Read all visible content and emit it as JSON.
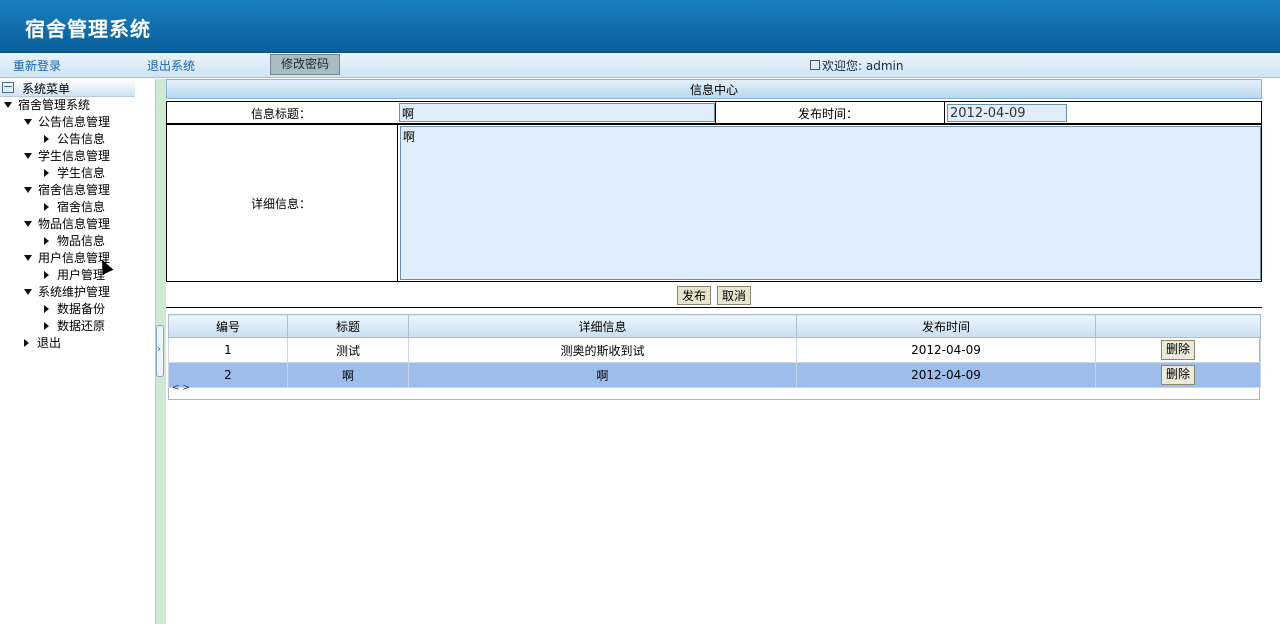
{
  "header": {
    "title": "宿舍管理系统"
  },
  "toolbar": {
    "relogin": "重新登录",
    "logout": "退出系统",
    "change_password": "修改密码",
    "welcome": "欢迎您: admin"
  },
  "sidebar": {
    "menu_title": "系统菜单",
    "root": "宿舍管理系统",
    "groups": [
      {
        "label": "公告信息管理",
        "child": "公告信息"
      },
      {
        "label": "学生信息管理",
        "child": "学生信息"
      },
      {
        "label": "宿舍信息管理",
        "child": "宿舍信息"
      },
      {
        "label": "物品信息管理",
        "child": "物品信息"
      },
      {
        "label": "用户信息管理",
        "child": "用户管理"
      },
      {
        "label": "系统维护管理",
        "child1": "数据备份",
        "child2": "数据还原"
      }
    ],
    "exit": "退出"
  },
  "form": {
    "title": "信息中心",
    "title_label": "信息标题：",
    "title_value": "啊",
    "time_label": "发布时间：",
    "time_value": "2012-04-09",
    "detail_label": "详细信息：",
    "detail_value": "啊",
    "publish": "发布",
    "cancel": "取消"
  },
  "grid": {
    "columns": [
      "编号",
      "标题",
      "详细信息",
      "发布时间",
      ""
    ],
    "rows": [
      {
        "id": "1",
        "title": "测试",
        "detail": "测奥的斯收到试",
        "time": "2012-04-09",
        "action": "删除"
      },
      {
        "id": "2",
        "title": "啊",
        "detail": "啊",
        "time": "2012-04-09",
        "action": "删除"
      }
    ],
    "pager": "< >"
  }
}
